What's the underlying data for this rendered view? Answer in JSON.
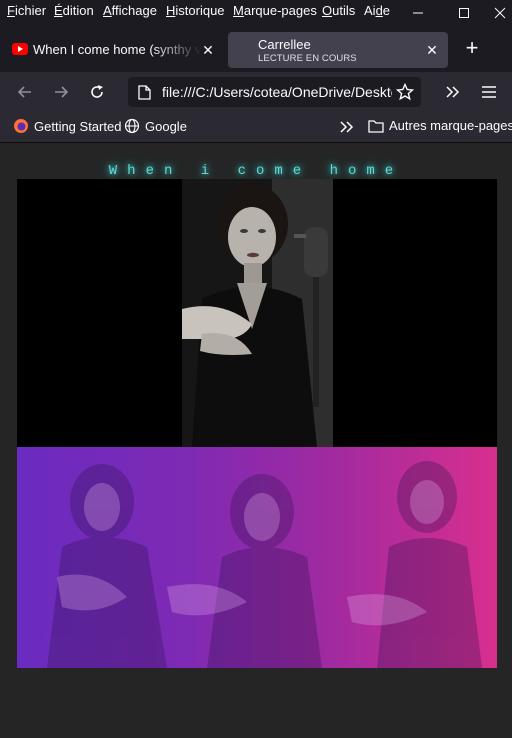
{
  "menu": {
    "items": [
      {
        "pre": "F",
        "rest": "ichier"
      },
      {
        "pre": "É",
        "rest": "dition"
      },
      {
        "pre": "A",
        "rest": "ffichage"
      },
      {
        "pre": "H",
        "rest": "istorique"
      },
      {
        "pre": "M",
        "rest": "arque-pages"
      },
      {
        "pre": "O",
        "rest": "utils"
      },
      {
        "pre": "Ai",
        "u": "d",
        "rest2": "e"
      }
    ]
  },
  "tabs": [
    {
      "title": "When I come home (synthy version)",
      "icon": "youtube-icon",
      "icon_color": "#ff0000"
    },
    {
      "title": "Carrellee",
      "subtitle": "LECTURE EN COURS",
      "active": true
    }
  ],
  "navbar": {
    "url": "file:///C:/Users/cotea/OneDrive/Desktop/"
  },
  "bookmarks": [
    {
      "label": "Getting Started",
      "icon": "firefox-icon"
    },
    {
      "label": "Google",
      "icon": "globe-icon"
    },
    {
      "label": "Autres marque-pages",
      "icon": "folder-icon"
    }
  ],
  "page": {
    "title": "When i come home"
  },
  "colors": {
    "title_glow": "#5fd8d4",
    "gradient_start": "#6a2bc0",
    "gradient_end": "#d82f8e"
  }
}
